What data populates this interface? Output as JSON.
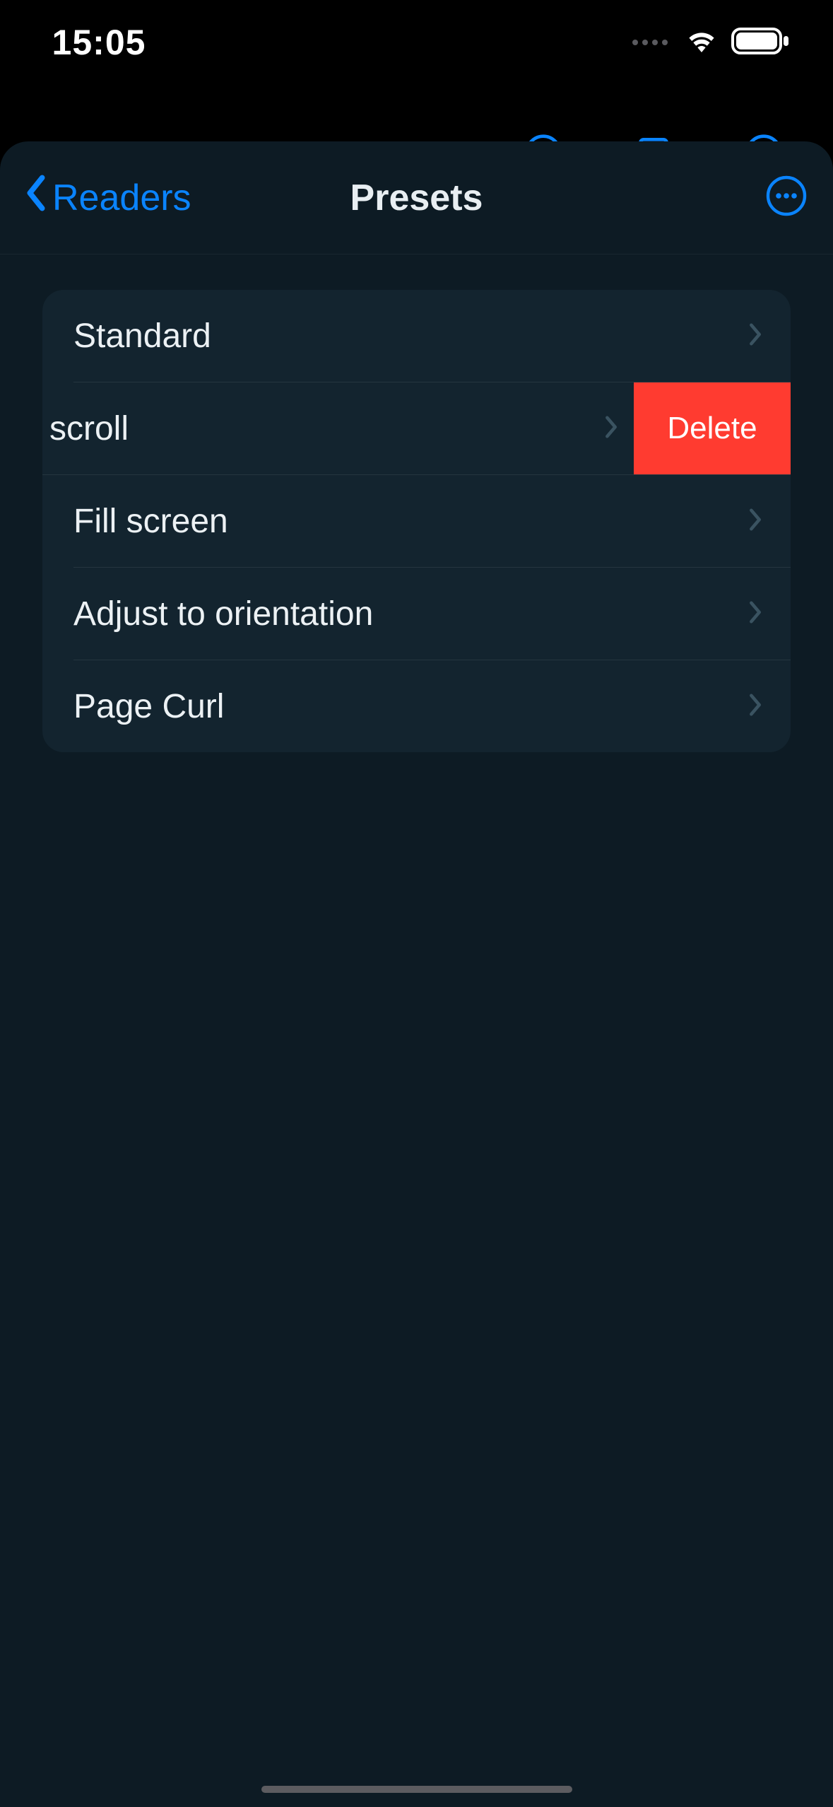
{
  "status": {
    "time": "15:05"
  },
  "nav": {
    "back_label": "Readers",
    "title": "Presets"
  },
  "presets": {
    "items": [
      {
        "label": "Standard"
      },
      {
        "label": "scroll"
      },
      {
        "label": "Fill screen"
      },
      {
        "label": "Adjust to orientation"
      },
      {
        "label": "Page Curl"
      }
    ],
    "swipe_action": "Delete"
  }
}
